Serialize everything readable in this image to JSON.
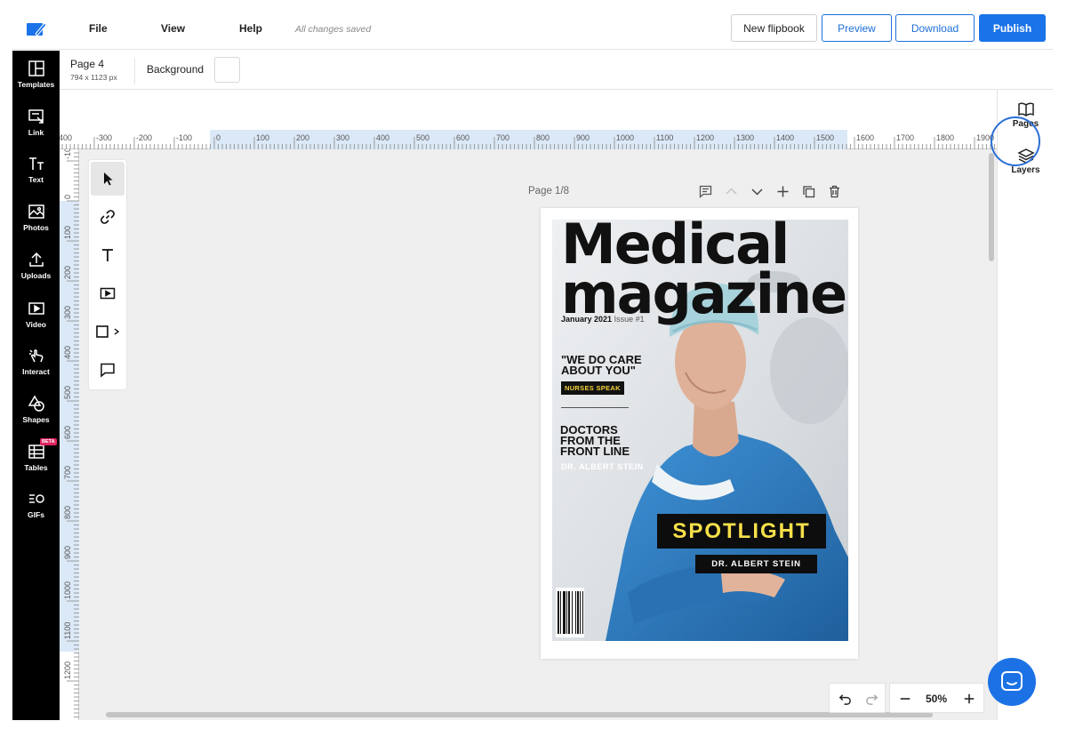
{
  "topbar": {
    "menu": [
      "File",
      "View",
      "Help"
    ],
    "saved_status": "All changes saved",
    "buttons": {
      "new_flipbook": "New flipbook",
      "preview": "Preview",
      "download": "Download",
      "publish": "Publish"
    },
    "accent_color": "#1a73e8"
  },
  "sidebar": {
    "items": [
      {
        "label": "Templates",
        "icon": "templates-icon"
      },
      {
        "label": "Link",
        "icon": "link-icon"
      },
      {
        "label": "Text",
        "icon": "text-icon"
      },
      {
        "label": "Photos",
        "icon": "photos-icon"
      },
      {
        "label": "Uploads",
        "icon": "upload-icon"
      },
      {
        "label": "Video",
        "icon": "video-icon"
      },
      {
        "label": "Interact",
        "icon": "interact-icon"
      },
      {
        "label": "Shapes",
        "icon": "shapes-icon"
      },
      {
        "label": "Tables",
        "icon": "tables-icon",
        "badge": "BETA"
      },
      {
        "label": "GIFs",
        "icon": "gifs-icon"
      }
    ]
  },
  "properties": {
    "page_name": "Page 4",
    "page_dimensions": "794 x 1123 px",
    "background_label": "Background",
    "background_color": "#ffffff"
  },
  "rightpanel": {
    "pages_label": "Pages",
    "layers_label": "Layers"
  },
  "rulers": {
    "top": [
      "-400",
      "-300",
      "-200",
      "-100",
      "0",
      "100",
      "200",
      "300",
      "400",
      "500",
      "600",
      "700",
      "800",
      "900",
      "1000",
      "1100",
      "1200",
      "1300",
      "1400",
      "1500",
      "1600",
      "1700",
      "1800",
      "1900"
    ],
    "left": [
      "-100",
      "0",
      "100",
      "200",
      "300",
      "400",
      "500",
      "600",
      "700",
      "800",
      "900",
      "1000",
      "1100",
      "1200"
    ]
  },
  "tools": [
    "select-tool-icon",
    "link-tool-icon",
    "text-tool-icon",
    "video-tool-icon",
    "shape-tool-icon",
    "comment-tool-icon"
  ],
  "canvas": {
    "page_label": "Page 1/8",
    "page_actions": [
      "comment-icon",
      "move-up-icon",
      "move-down-icon",
      "add-page-icon",
      "duplicate-icon",
      "delete-icon"
    ]
  },
  "cover": {
    "title_line1": "Medical",
    "title_line2": "magazine",
    "date": "January 2021",
    "issue": "Issue #1",
    "quote_line1": "\"WE DO CARE",
    "quote_line2": "ABOUT YOU\"",
    "quote_tag": "NURSES SPEAK",
    "story_line1": "DOCTORS",
    "story_line2": "FROM THE",
    "story_line3": "FRONT LINE",
    "story_author": "DR. ALBERT STEIN",
    "spotlight": "SPOTLIGHT",
    "spotlight_name": "DR. ALBERT STEIN"
  },
  "zoom": {
    "value": "50%"
  }
}
